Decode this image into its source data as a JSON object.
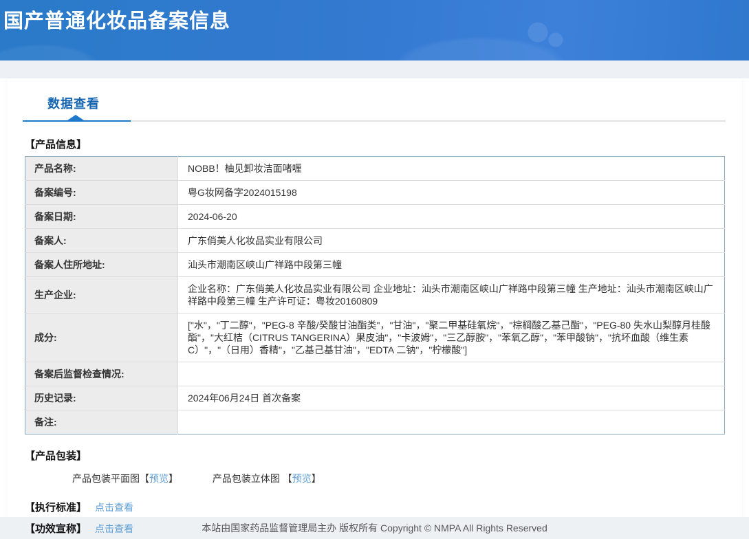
{
  "header": {
    "title": "国产普通化妆品备案信息"
  },
  "tabs": {
    "data_view": "数据查看"
  },
  "product_info": {
    "section_title": "【产品信息】",
    "rows": [
      {
        "label": "产品名称:",
        "value": "NOBB！柚见卸妆洁面啫喱"
      },
      {
        "label": "备案编号:",
        "value": "粤G妆网备字2024015198"
      },
      {
        "label": "备案日期:",
        "value": "2024-06-20"
      },
      {
        "label": "备案人:",
        "value": "广东俏美人化妆品实业有限公司"
      },
      {
        "label": "备案人住所地址:",
        "value": "汕头市潮南区峡山广祥路中段第三幢"
      },
      {
        "label": "生产企业:",
        "value": "企业名称：广东俏美人化妆品实业有限公司 企业地址：汕头市潮南区峡山广祥路中段第三幢 生产地址：汕头市潮南区峡山广祥路中段第三幢 生产许可证：粤妆20160809"
      },
      {
        "label": "成分:",
        "value": "[\"水\"，\"丁二醇\"，\"PEG-8 辛酸/癸酸甘油酯类\"，\"甘油\"，\"聚二甲基硅氧烷\"，\"棕榈酸乙基己酯\"，\"PEG-80 失水山梨醇月桂酸酯\"，\"大红桔（CITRUS TANGERINA）果皮油\"，\"卡波姆\"，\"三乙醇胺\"，\"苯氧乙醇\"，\"苯甲酸钠\"，\"抗坏血酸（维生素C）\"，\"（日用）香精\"，\"乙基己基甘油\"，\"EDTA 二钠\"，\"柠檬酸\"]"
      },
      {
        "label": "备案后监督检查情况:",
        "value": ""
      },
      {
        "label": "历史记录:",
        "value": "2024年06月24日 首次备案"
      },
      {
        "label": "备注:",
        "value": ""
      }
    ]
  },
  "packaging": {
    "section_title": "【产品包装】",
    "flat_label": "产品包装平面图",
    "stereo_label": "产品包装立体图 ",
    "preview_label": "预览",
    "bracket_open": "【",
    "bracket_close": "】"
  },
  "standard": {
    "label": "【执行标准】",
    "link": "点击查看"
  },
  "efficacy": {
    "label": "【功效宣称】",
    "link": "点击查看"
  },
  "footer": {
    "text": "本站由国家药品监督管理局主办 版权所有 Copyright © NMPA All Rights Reserved"
  },
  "colors": {
    "header_blue": "#3c80da",
    "accent_blue": "#1e79cc",
    "tab_text_blue": "#1565b0",
    "link_blue": "#5e9ed6",
    "table_border": "#8ba9bc",
    "label_cell_bg": "#ececec",
    "band_bg": "#edf1f5"
  }
}
